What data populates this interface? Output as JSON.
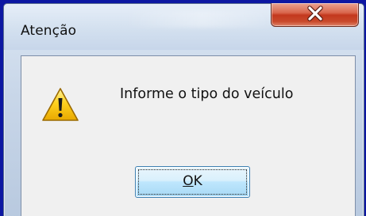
{
  "window": {
    "title": "Atenção",
    "close_icon": "close-x-icon"
  },
  "dialog": {
    "icon": "warning-triangle-icon",
    "message": "Informe o tipo do veículo",
    "ok_accel": "O",
    "ok_rest": "K"
  },
  "colors": {
    "frame_accent": "#0c17a2",
    "close_button": "#c3381e",
    "warning_yellow": "#f5c400",
    "ok_border": "#3c7fb1"
  }
}
